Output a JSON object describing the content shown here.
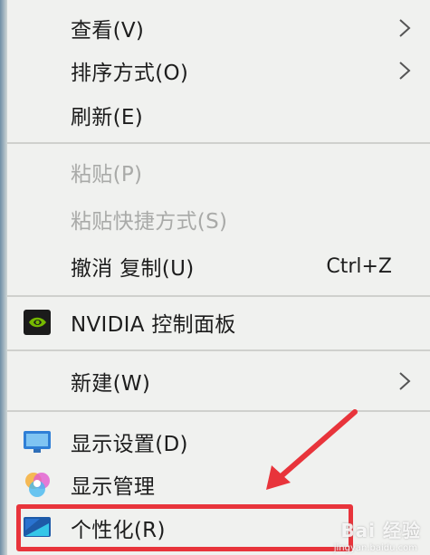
{
  "menu": {
    "view": {
      "label": "查看(V)"
    },
    "sort": {
      "label": "排序方式(O)"
    },
    "refresh": {
      "label": "刷新(E)"
    },
    "paste": {
      "label": "粘贴(P)"
    },
    "paste_shortcut": {
      "label": "粘贴快捷方式(S)"
    },
    "undo_copy": {
      "label": "撤消 复制(U)",
      "shortcut": "Ctrl+Z"
    },
    "nvidia": {
      "label": "NVIDIA 控制面板",
      "icon": "nvidia-icon"
    },
    "new": {
      "label": "新建(W)"
    },
    "display_settings": {
      "label": "显示设置(D)",
      "icon": "display-icon"
    },
    "display_manage": {
      "label": "显示管理",
      "icon": "color-wheel-icon"
    },
    "personalize": {
      "label": "个性化(R)",
      "icon": "personalize-icon"
    }
  },
  "annotation": {
    "highlight_color": "#e8343b",
    "arrow_color": "#e8343b"
  },
  "watermark": {
    "text": "Bai 经验",
    "sub": "jingyan.baidu.com"
  }
}
